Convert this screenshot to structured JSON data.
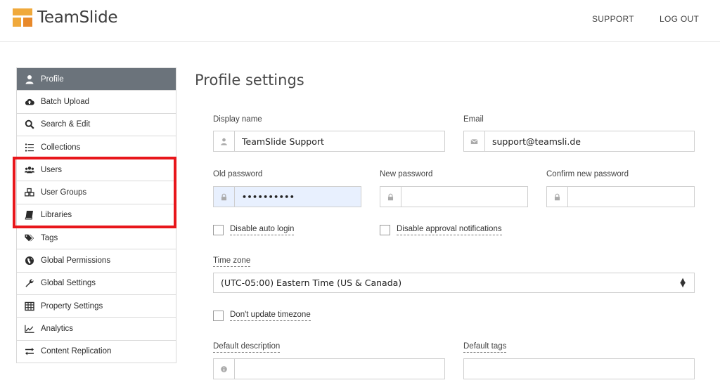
{
  "header": {
    "brand": "TeamSlide",
    "links": {
      "support": "SUPPORT",
      "logout": "LOG OUT"
    }
  },
  "sidebar": {
    "items": [
      {
        "label": "Profile",
        "icon": "user-icon",
        "active": true
      },
      {
        "label": "Batch Upload",
        "icon": "cloud-upload-icon"
      },
      {
        "label": "Search & Edit",
        "icon": "search-icon"
      },
      {
        "label": "Collections",
        "icon": "list-icon"
      },
      {
        "label": "Users",
        "icon": "users-icon"
      },
      {
        "label": "User Groups",
        "icon": "cubes-icon"
      },
      {
        "label": "Libraries",
        "icon": "book-icon"
      },
      {
        "label": "Tags",
        "icon": "tags-icon"
      },
      {
        "label": "Global Permissions",
        "icon": "globe-icon"
      },
      {
        "label": "Global Settings",
        "icon": "wrench-icon"
      },
      {
        "label": "Property Settings",
        "icon": "table-icon"
      },
      {
        "label": "Analytics",
        "icon": "line-chart-icon"
      },
      {
        "label": "Content Replication",
        "icon": "exchange-icon"
      }
    ],
    "highlight_color": "#e8161b"
  },
  "main": {
    "title": "Profile settings",
    "display_name": {
      "label": "Display name",
      "value": "TeamSlide Support",
      "icon": "user-icon"
    },
    "email": {
      "label": "Email",
      "value": "support@teamsli.de",
      "icon": "envelope-icon"
    },
    "old_password": {
      "label": "Old password",
      "value": "••••••••••",
      "icon": "lock-icon"
    },
    "new_password": {
      "label": "New password",
      "value": "",
      "icon": "lock-icon"
    },
    "confirm_password": {
      "label": "Confirm new password",
      "value": "",
      "icon": "lock-icon"
    },
    "disable_auto_login": {
      "label": "Disable auto login",
      "checked": false
    },
    "disable_approval": {
      "label": "Disable approval notifications",
      "checked": false
    },
    "timezone": {
      "label": "Time zone",
      "value": "(UTC-05:00) Eastern Time (US & Canada)",
      "arrows": "▲▼"
    },
    "dont_update_tz": {
      "label": "Don't update timezone",
      "checked": false
    },
    "default_description": {
      "label": "Default description",
      "value": "",
      "icon": "info-icon"
    },
    "default_tags": {
      "label": "Default tags",
      "value": ""
    }
  },
  "colors": {
    "accent": "#f0a93b",
    "active_nav": "#6b737b",
    "autofill": "#e8f0fe"
  }
}
